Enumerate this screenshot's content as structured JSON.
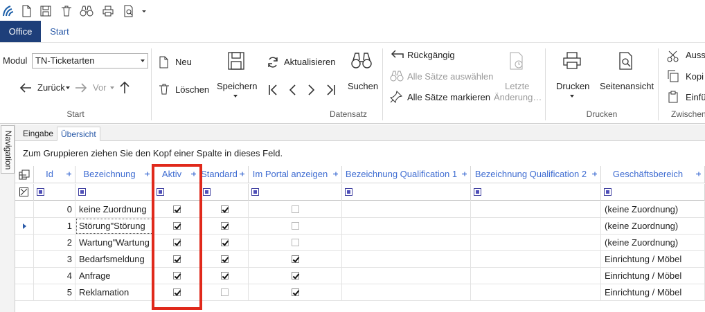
{
  "tabs": {
    "office": "Office",
    "start": "Start"
  },
  "module": {
    "label": "Modul",
    "value": "TN-Ticketarten"
  },
  "nav": {
    "back": "Zurück",
    "forward": "Vor"
  },
  "ribbon": {
    "groups": {
      "start": "Start",
      "datensatz": "Datensatz",
      "drucken": "Drucken",
      "zwischen": "Zwischen"
    },
    "neu": "Neu",
    "loeschen": "Löschen",
    "speichern": "Speichern",
    "aktualisieren": "Aktualisieren",
    "suchen": "Suchen",
    "rueckgaengig": "Rückgängig",
    "alle_auswaehlen": "Alle Sätze auswählen",
    "alle_markieren": "Alle Sätze markieren",
    "letzte_line1": "Letzte",
    "letzte_line2": "Änderung…",
    "drucken": "Drucken",
    "seitenansicht": "Seitenansicht",
    "ausschneiden": "Auss",
    "kopieren": "Kopi",
    "einfuegen": "Einfü"
  },
  "side_nav_label": "Navigation",
  "subtabs": {
    "eingabe": "Eingabe",
    "uebersicht": "Übersicht"
  },
  "group_hint": "Zum Gruppieren ziehen Sie den Kopf einer Spalte in dieses Feld.",
  "columns": {
    "id": "Id",
    "bezeichnung": "Bezeichnung",
    "aktiv": "Aktiv",
    "standard": "Standard",
    "portal": "Im Portal anzeigen",
    "qual1": "Bezeichnung Qualification 1",
    "qual2": "Bezeichnung Qualification 2",
    "geschaeft": "Geschäftsbereich"
  },
  "rows": [
    {
      "id": "0",
      "bezeichnung": "keine Zuordnung",
      "aktiv": true,
      "standard": true,
      "portal": false,
      "qual1": "",
      "qual2": "",
      "geschaeft": "(keine Zuordnung)"
    },
    {
      "id": "1",
      "bezeichnung": "Störung\"Störung",
      "aktiv": true,
      "standard": true,
      "portal": false,
      "qual1": "",
      "qual2": "",
      "geschaeft": "(keine Zuordnung)"
    },
    {
      "id": "2",
      "bezeichnung": "Wartung\"Wartung",
      "aktiv": true,
      "standard": true,
      "portal": false,
      "qual1": "",
      "qual2": "",
      "geschaeft": "(keine Zuordnung)"
    },
    {
      "id": "3",
      "bezeichnung": "Bedarfsmeldung",
      "aktiv": true,
      "standard": true,
      "portal": true,
      "qual1": "",
      "qual2": "",
      "geschaeft": "Einrichtung / Möbel"
    },
    {
      "id": "4",
      "bezeichnung": "Anfrage",
      "aktiv": true,
      "standard": true,
      "portal": true,
      "qual1": "",
      "qual2": "",
      "geschaeft": "Einrichtung / Möbel"
    },
    {
      "id": "5",
      "bezeichnung": "Reklamation",
      "aktiv": true,
      "standard": false,
      "portal": true,
      "qual1": "",
      "qual2": "",
      "geschaeft": "Einrichtung / Möbel"
    }
  ],
  "current_row": 1,
  "colors": {
    "office_tab": "#1e3f7a",
    "accent": "#2a5aa8",
    "header_text": "#3d6bd1",
    "highlight": "#e0291b"
  }
}
